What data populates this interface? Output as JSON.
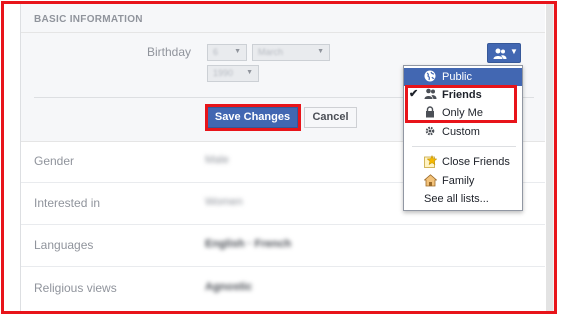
{
  "section": {
    "title": "BASIC INFORMATION"
  },
  "birthday": {
    "label": "Birthday",
    "day": "6",
    "month": "March",
    "year": "1990"
  },
  "actions": {
    "save_label": "Save Changes",
    "cancel_label": "Cancel"
  },
  "rows": [
    {
      "label": "Gender",
      "value": "Male"
    },
    {
      "label": "Interested in",
      "value": "Women"
    },
    {
      "label": "Languages",
      "value": "English · French"
    },
    {
      "label": "Religious views",
      "value": "Agnostic"
    }
  ],
  "privacy_menu": {
    "items": [
      {
        "label": "Public",
        "icon": "globe-icon",
        "selected": true
      },
      {
        "label": "Friends",
        "icon": "friends-icon",
        "checked": true
      },
      {
        "label": "Only Me",
        "icon": "lock-icon"
      },
      {
        "label": "Custom",
        "icon": "gear-icon"
      },
      {
        "label": "Close Friends",
        "icon": "star-icon"
      },
      {
        "label": "Family",
        "icon": "house-icon"
      }
    ],
    "see_all": "See all lists..."
  },
  "colors": {
    "accent": "#4267b2",
    "annotation": "#e8141a"
  }
}
